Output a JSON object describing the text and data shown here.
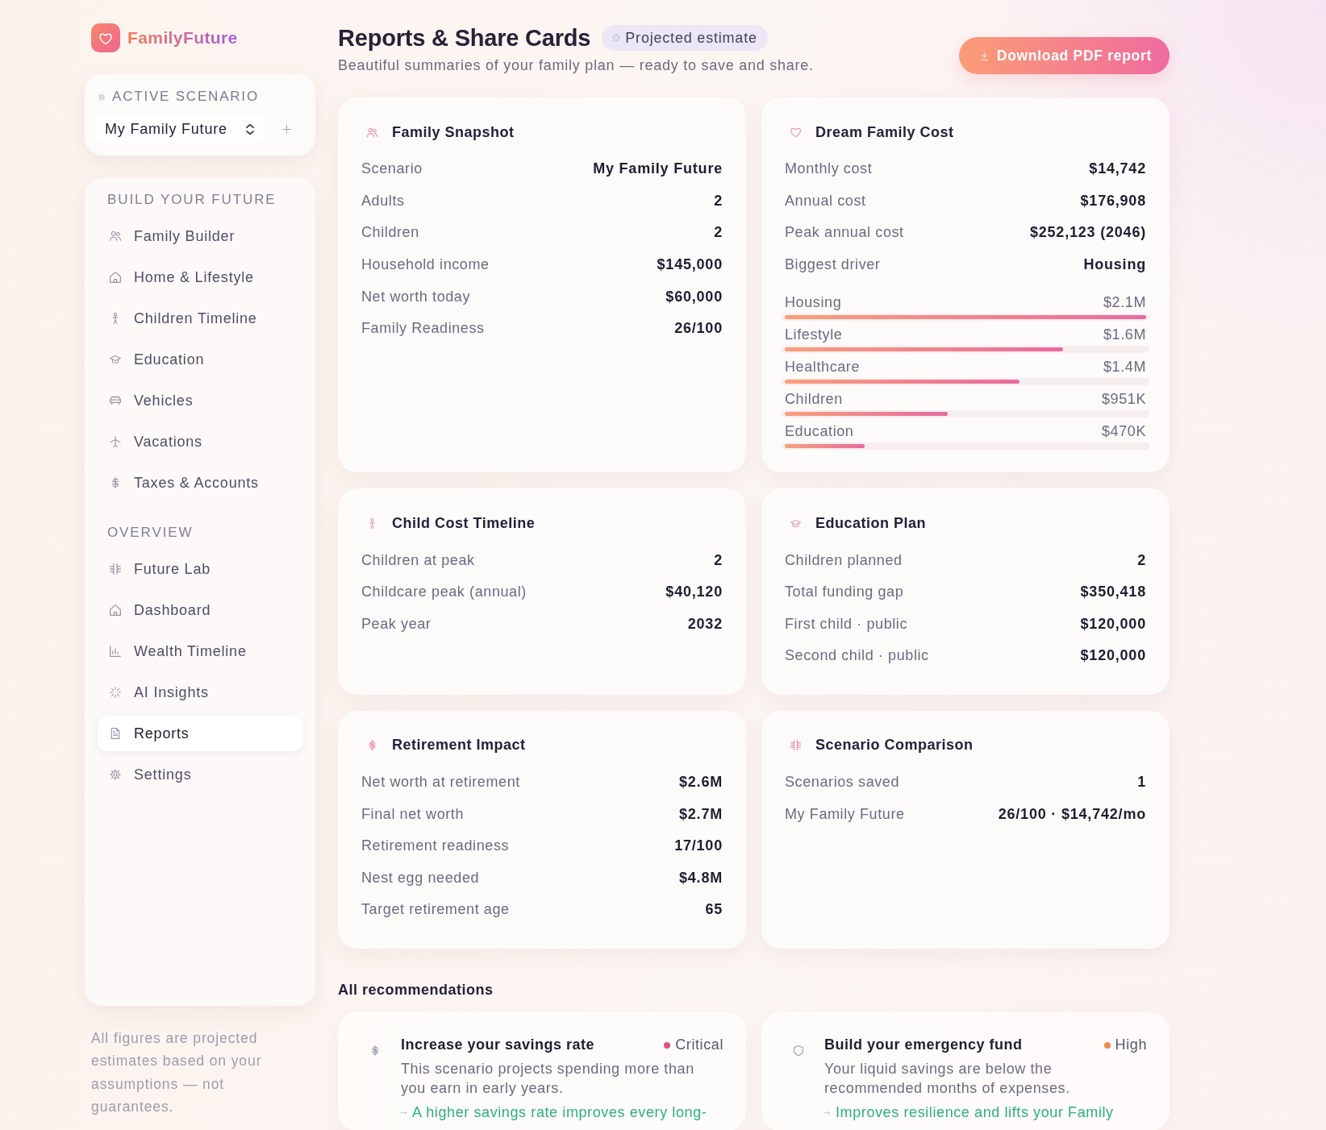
{
  "brand": {
    "name": "FamilyFuture"
  },
  "scenario_picker": {
    "label": "ACTIVE SCENARIO",
    "value": "My Family Future"
  },
  "sidebar": {
    "sections": [
      {
        "title": "BUILD YOUR FUTURE",
        "items": [
          {
            "label": "Family Builder",
            "selected": false
          },
          {
            "label": "Home & Lifestyle",
            "selected": false
          },
          {
            "label": "Children Timeline",
            "selected": false
          },
          {
            "label": "Education",
            "selected": false
          },
          {
            "label": "Vehicles",
            "selected": false
          },
          {
            "label": "Vacations",
            "selected": false
          },
          {
            "label": "Taxes & Accounts",
            "selected": false
          }
        ]
      },
      {
        "title": "OVERVIEW",
        "items": [
          {
            "label": "Future Lab",
            "selected": false
          },
          {
            "label": "Dashboard",
            "selected": false
          },
          {
            "label": "Wealth Timeline",
            "selected": false
          },
          {
            "label": "AI Insights",
            "selected": false
          },
          {
            "label": "Reports",
            "selected": true
          },
          {
            "label": "Settings",
            "selected": false
          }
        ]
      }
    ],
    "footnote": "All figures are projected estimates based on your assumptions — not guarantees."
  },
  "header": {
    "title": "Reports & Share Cards",
    "badge": "Projected estimate",
    "subtitle": "Beautiful summaries of your family plan — ready to save and share.",
    "download_button": "Download PDF report"
  },
  "cards": [
    {
      "title": "Family Snapshot",
      "rows": [
        {
          "label": "Scenario",
          "value": "My Family Future"
        },
        {
          "label": "Adults",
          "value": "2"
        },
        {
          "label": "Children",
          "value": "2"
        },
        {
          "label": "Household income",
          "value": "$145,000"
        },
        {
          "label": "Net worth today",
          "value": "$60,000"
        },
        {
          "label": "Family Readiness",
          "value": "26/100"
        }
      ]
    },
    {
      "title": "Dream Family Cost",
      "rows": [
        {
          "label": "Monthly cost",
          "value": "$14,742"
        },
        {
          "label": "Annual cost",
          "value": "$176,908"
        },
        {
          "label": "Peak annual cost",
          "value": "$252,123 (2046)"
        },
        {
          "label": "Biggest driver",
          "value": "Housing"
        }
      ],
      "breakdown": [
        {
          "label": "Housing",
          "value": "$2.1M",
          "level": 1.0
        },
        {
          "label": "Lifestyle",
          "value": "$1.6M",
          "level": 0.77
        },
        {
          "label": "Healthcare",
          "value": "$1.4M",
          "level": 0.65
        },
        {
          "label": "Children",
          "value": "$951K",
          "level": 0.45
        },
        {
          "label": "Education",
          "value": "$470K",
          "level": 0.22
        }
      ]
    },
    {
      "title": "Child Cost Timeline",
      "rows": [
        {
          "label": "Children at peak",
          "value": "2"
        },
        {
          "label": "Childcare peak (annual)",
          "value": "$40,120"
        },
        {
          "label": "Peak year",
          "value": "2032"
        }
      ]
    },
    {
      "title": "Education Plan",
      "rows": [
        {
          "label": "Children planned",
          "value": "2"
        },
        {
          "label": "Total funding gap",
          "value": "$350,418"
        },
        {
          "label": "First child · public",
          "value": "$120,000"
        },
        {
          "label": "Second child · public",
          "value": "$120,000"
        }
      ]
    },
    {
      "title": "Retirement Impact",
      "rows": [
        {
          "label": "Net worth at retirement",
          "value": "$2.6M"
        },
        {
          "label": "Final net worth",
          "value": "$2.7M"
        },
        {
          "label": "Retirement readiness",
          "value": "17/100"
        },
        {
          "label": "Nest egg needed",
          "value": "$4.8M"
        },
        {
          "label": "Target retirement age",
          "value": "65"
        }
      ]
    },
    {
      "title": "Scenario Comparison",
      "rows": [
        {
          "label": "Scenarios saved",
          "value": "1"
        },
        {
          "label": "My Family Future",
          "value": "26/100 · $14,742/mo"
        }
      ]
    }
  ],
  "recommendations": {
    "title": "All recommendations",
    "items": [
      {
        "title": "Increase your savings rate",
        "priority": "Critical",
        "color": "#e0508a",
        "description": "This scenario projects spending more than you earn in early years.",
        "benefit": "A higher savings rate improves every long-"
      },
      {
        "title": "Build your emergency fund",
        "priority": "High",
        "color": "#f4874f",
        "description": "Your liquid savings are below the recommended months of expenses.",
        "benefit": "Improves resilience and lifts your Family"
      }
    ]
  }
}
